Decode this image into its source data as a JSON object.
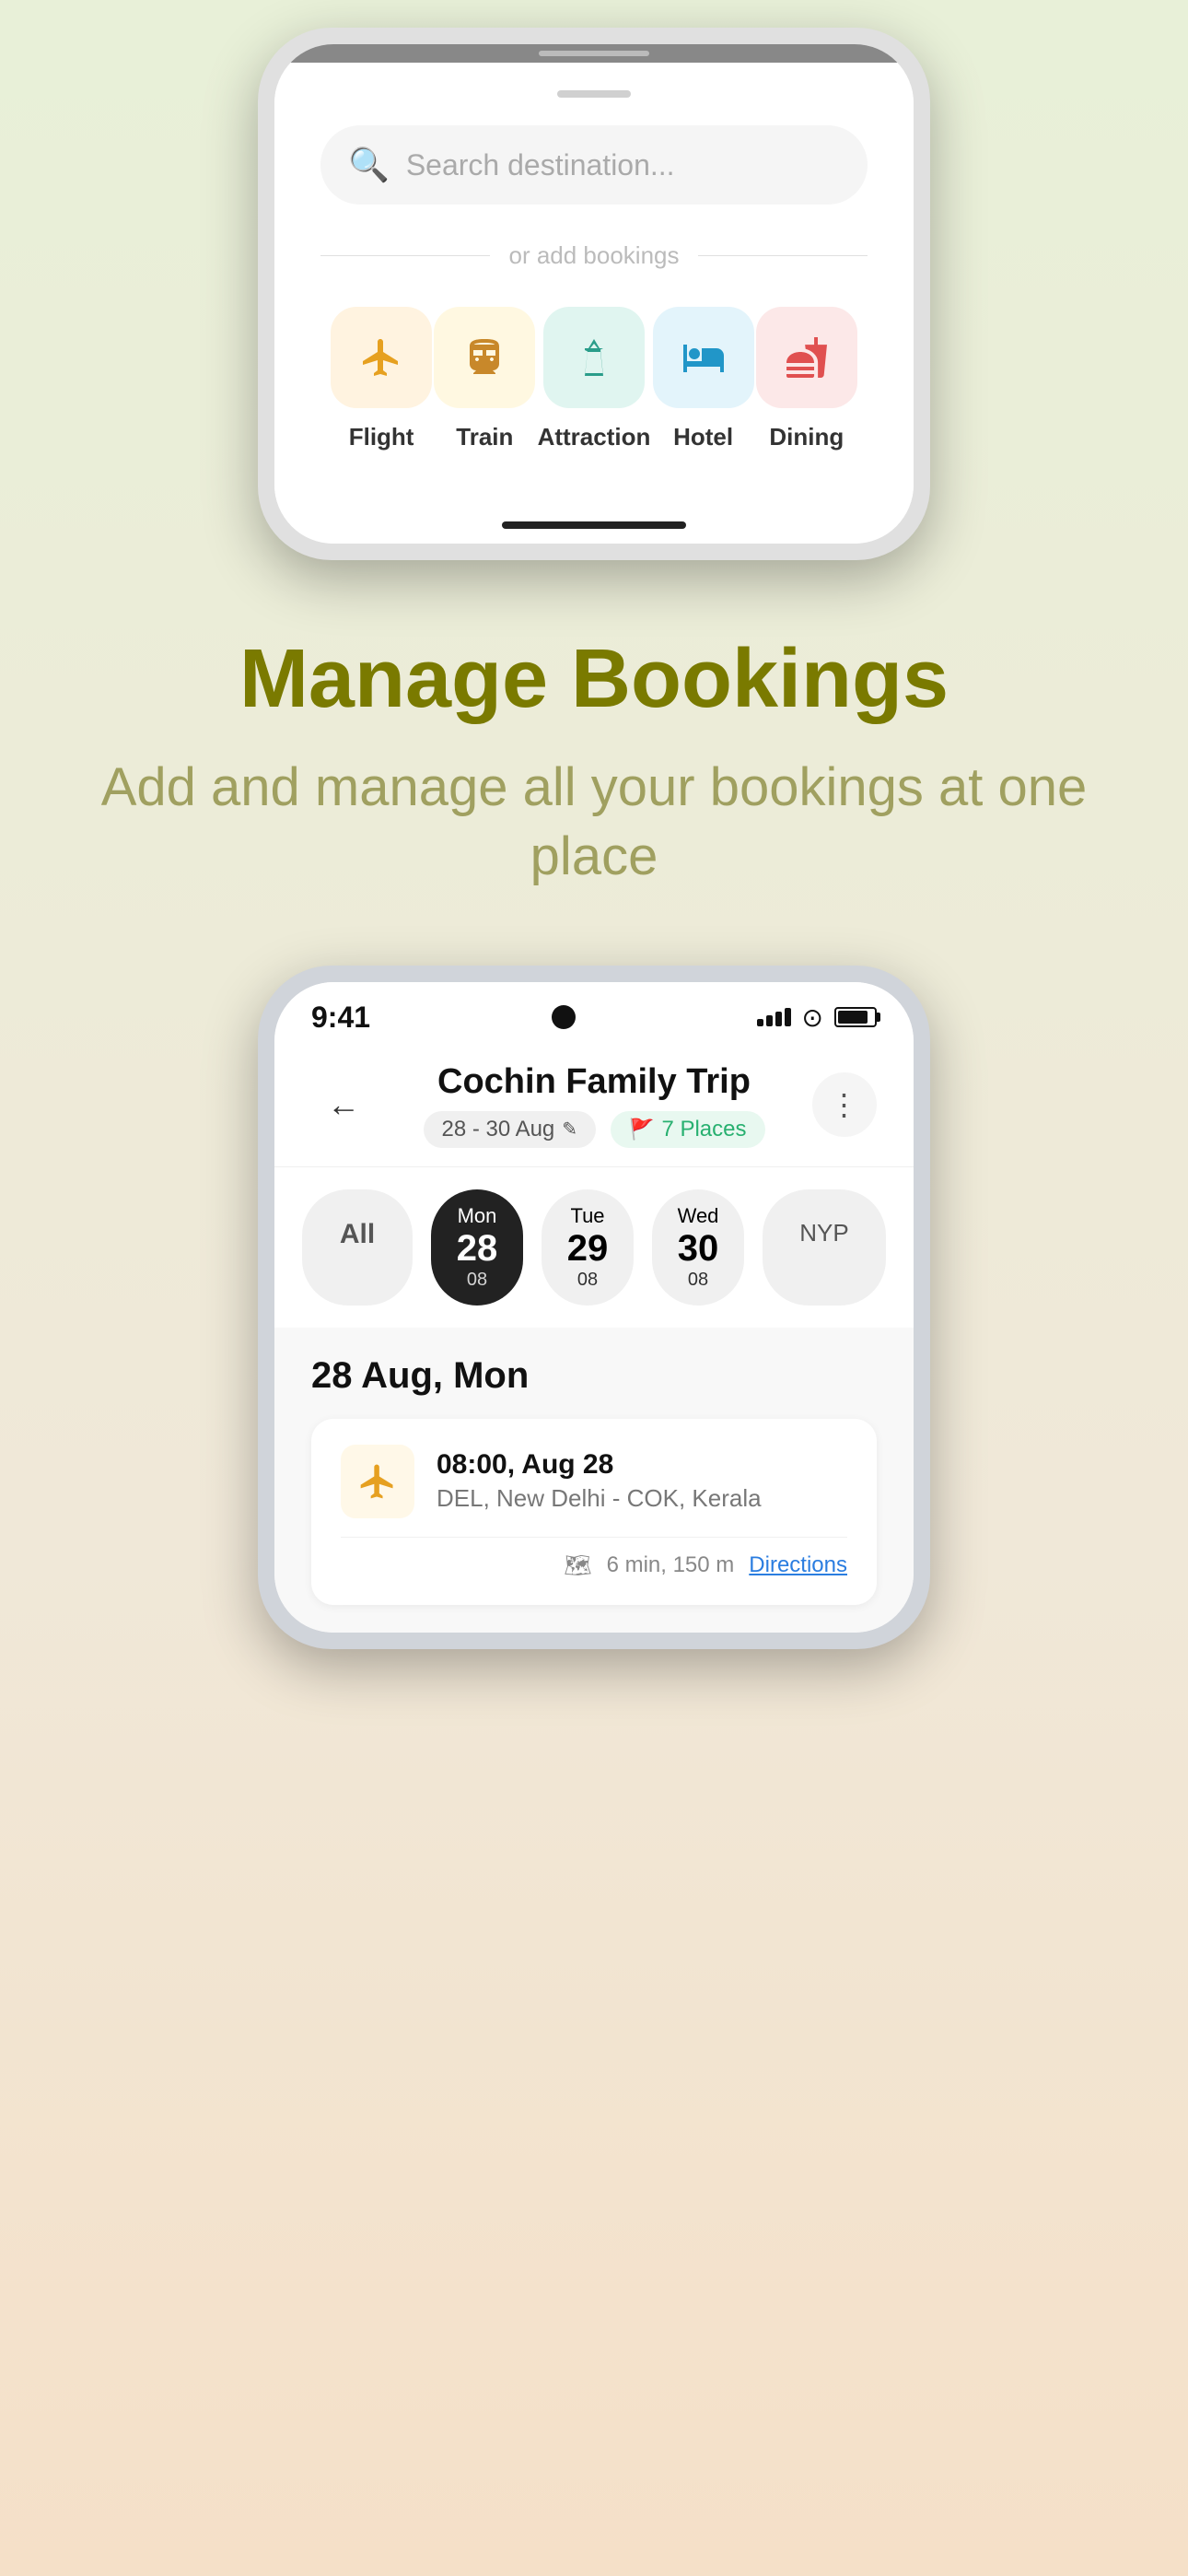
{
  "app": {
    "background": "#e8f0d8"
  },
  "phone1": {
    "search": {
      "placeholder": "Search destination..."
    },
    "divider": "or add bookings",
    "bookings": [
      {
        "id": "flight",
        "label": "Flight",
        "icon": "✈",
        "color_class": "icon-flight"
      },
      {
        "id": "train",
        "label": "Train",
        "icon": "🚆",
        "color_class": "icon-train"
      },
      {
        "id": "attraction",
        "label": "Attraction",
        "icon": "🗼",
        "color_class": "icon-attraction"
      },
      {
        "id": "hotel",
        "label": "Hotel",
        "icon": "🛏",
        "color_class": "icon-hotel"
      },
      {
        "id": "dining",
        "label": "Dining",
        "icon": "🍴",
        "color_class": "icon-dining"
      }
    ]
  },
  "middle": {
    "heading": "Manage Bookings",
    "subheading": "Add and manage all your bookings at one place"
  },
  "phone2": {
    "status": {
      "time": "9:41"
    },
    "header": {
      "back_label": "←",
      "trip_title": "Cochin Family Trip",
      "date_range": "28 - 30 Aug",
      "edit_icon": "✎",
      "places_count": "7 Places",
      "more_icon": "⋮"
    },
    "day_selector": {
      "all_label": "All",
      "days": [
        {
          "name": "Mon",
          "number": "28",
          "month": "08",
          "active": true
        },
        {
          "name": "Tue",
          "number": "29",
          "month": "08",
          "active": false
        },
        {
          "name": "Wed",
          "number": "30",
          "month": "08",
          "active": false
        },
        {
          "name": "",
          "number": "NYP",
          "month": "",
          "active": false
        }
      ]
    },
    "day_content": {
      "date_label": "28 Aug, Mon",
      "booking": {
        "time": "08:00, Aug 28",
        "route": "DEL, New Delhi  -  COK, Kerala",
        "map_icon": "🗺",
        "distance": "6 min, 150 m",
        "directions_label": "Directions"
      }
    }
  }
}
